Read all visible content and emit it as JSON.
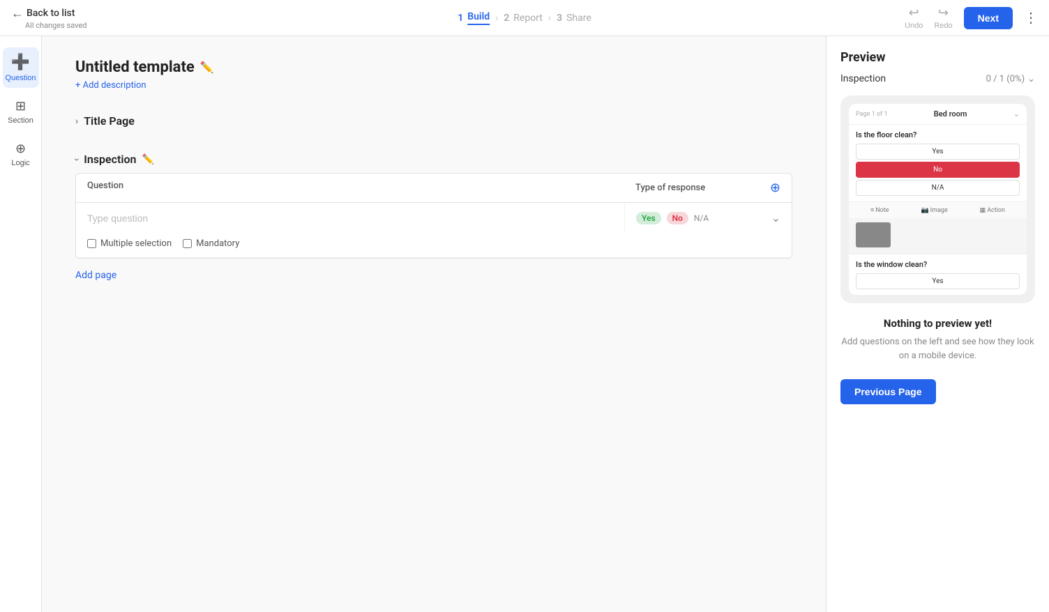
{
  "nav": {
    "back_label": "Back to list",
    "back_sub": "All changes saved",
    "steps": [
      {
        "num": "1",
        "label": "Build",
        "active": true
      },
      {
        "num": "2",
        "label": "Report",
        "active": false
      },
      {
        "num": "3",
        "label": "Share",
        "active": false
      }
    ],
    "undo_label": "Undo",
    "redo_label": "Redo",
    "next_label": "Next"
  },
  "sidebar": {
    "buttons": [
      {
        "icon": "➕",
        "label": "Question",
        "active": true
      },
      {
        "icon": "▦",
        "label": "Section",
        "active": false
      },
      {
        "icon": "⊕",
        "label": "Logic",
        "active": false
      }
    ]
  },
  "template": {
    "title": "Untitled template",
    "add_description": "+ Add description",
    "sections": [
      {
        "title": "Title Page",
        "expanded": false
      },
      {
        "title": "Inspection",
        "expanded": true,
        "table": {
          "col_question": "Question",
          "col_response": "Type of response",
          "rows": [
            {
              "placeholder": "Type question",
              "response_options": [
                "Yes",
                "No",
                "N/A"
              ],
              "multiple_selection": false,
              "mandatory": false
            }
          ]
        }
      }
    ],
    "add_page_label": "Add page"
  },
  "preview": {
    "title": "Preview",
    "inspection_label": "Inspection",
    "progress": "0 / 1 (0%)",
    "phone": {
      "page_label": "Page 1 of 1",
      "section_name": "Bed room",
      "questions": [
        {
          "text": "Is the floor clean?",
          "answers": [
            "Yes",
            "No",
            "N/A"
          ],
          "selected": "No"
        },
        {
          "text": "Is the window clean?",
          "answers": [
            "Yes"
          ],
          "selected": null
        }
      ],
      "tools": [
        "Note",
        "Image",
        "Action"
      ]
    },
    "empty_title": "Nothing to preview yet!",
    "empty_desc": "Add questions on the left and see how they look on a mobile device.",
    "prev_page_label": "Previous Page"
  }
}
